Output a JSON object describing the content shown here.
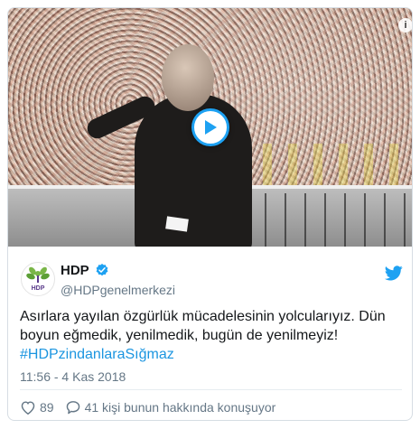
{
  "video": {
    "play_icon": "play-icon",
    "info_icon": "info-icon",
    "info_glyph": "i"
  },
  "account": {
    "name": "HDP",
    "handle": "@HDPgenelmerkezi",
    "verified_icon": "verified-badge-icon",
    "avatar_icon": "hdp-logo-icon",
    "avatar_caption": "HDP"
  },
  "tweet": {
    "text": "Asırlara yayılan özgürlük mücadelesinin yolcularıyız. Dün boyun eğmedik, yenilmedik, bugün de yenilmeyiz! ",
    "hashtag": "#HDPzindanlaraSığmaz",
    "timestamp": "11:56 - 4 Kas 2018"
  },
  "actions": {
    "likes": "89",
    "conversation": "41 kişi bunun hakkında konuşuyor"
  },
  "colors": {
    "accent": "#1da1f2",
    "text": "#14171a",
    "muted": "#657786"
  }
}
